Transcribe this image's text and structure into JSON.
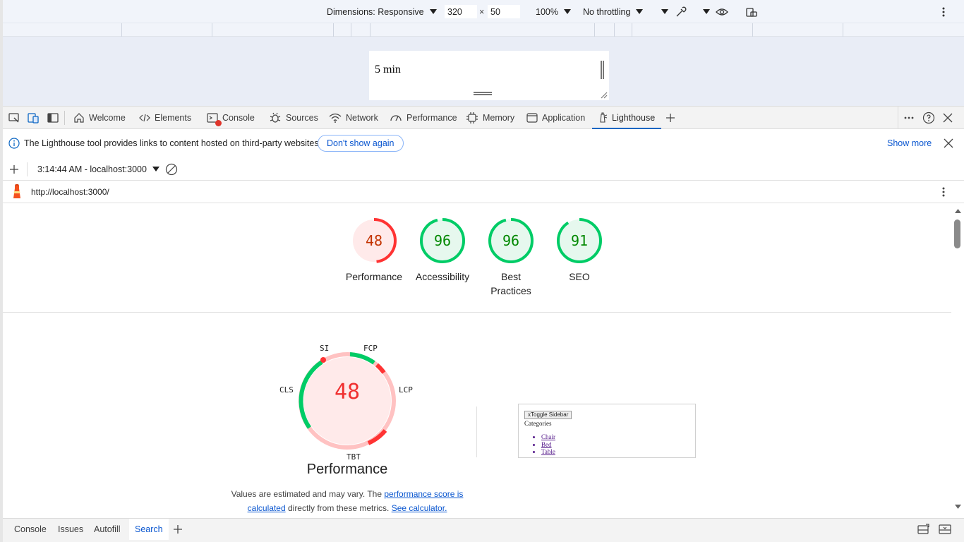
{
  "device_toolbar": {
    "dimensions_label": "Dimensions: Responsive",
    "width": "320",
    "times": "×",
    "height": "50",
    "zoom": "100%",
    "throttling": "No throttling"
  },
  "viewport": {
    "content_text": "5 min"
  },
  "tabs": [
    {
      "label": "Welcome"
    },
    {
      "label": "Elements"
    },
    {
      "label": "Console"
    },
    {
      "label": "Sources"
    },
    {
      "label": "Network"
    },
    {
      "label": "Performance"
    },
    {
      "label": "Memory"
    },
    {
      "label": "Application"
    },
    {
      "label": "Lighthouse"
    }
  ],
  "infobar": {
    "message": "The Lighthouse tool provides links to content hosted on third-party websites.",
    "dont_show_label": "Don't show again",
    "show_more_label": "Show more"
  },
  "report_selector": {
    "current": "3:14:44 AM - localhost:3000"
  },
  "url": "http://localhost:3000/",
  "scores": [
    {
      "value": 48,
      "label": "Performance",
      "color": "#c33300",
      "ring": "#ff3333",
      "bg": "#ffeaea"
    },
    {
      "value": 96,
      "label": "Accessibility",
      "color": "#008800",
      "ring": "#00cc66",
      "bg": "#e6f8ee"
    },
    {
      "value": 96,
      "label": "Best Practices",
      "color": "#008800",
      "ring": "#00cc66",
      "bg": "#e6f8ee"
    },
    {
      "value": 91,
      "label": "SEO",
      "color": "#008800",
      "ring": "#00cc66",
      "bg": "#e6f8ee"
    }
  ],
  "performance": {
    "score": "48",
    "title": "Performance",
    "metrics": {
      "si": "SI",
      "fcp": "FCP",
      "lcp": "LCP",
      "tbt": "TBT",
      "cls": "CLS"
    },
    "note_pre": "Values are estimated and may vary. The ",
    "note_link1": "performance score is calculated",
    "note_mid": " directly from these metrics. ",
    "note_link2": "See calculator."
  },
  "thumbnail": {
    "toggle": "xToggle Sidebar",
    "categories": "Categories",
    "items": [
      "Chair",
      "Bed",
      "Table"
    ]
  },
  "drawer": {
    "tabs": [
      {
        "label": "Console"
      },
      {
        "label": "Issues"
      },
      {
        "label": "Autofill"
      },
      {
        "label": "Search"
      }
    ]
  }
}
